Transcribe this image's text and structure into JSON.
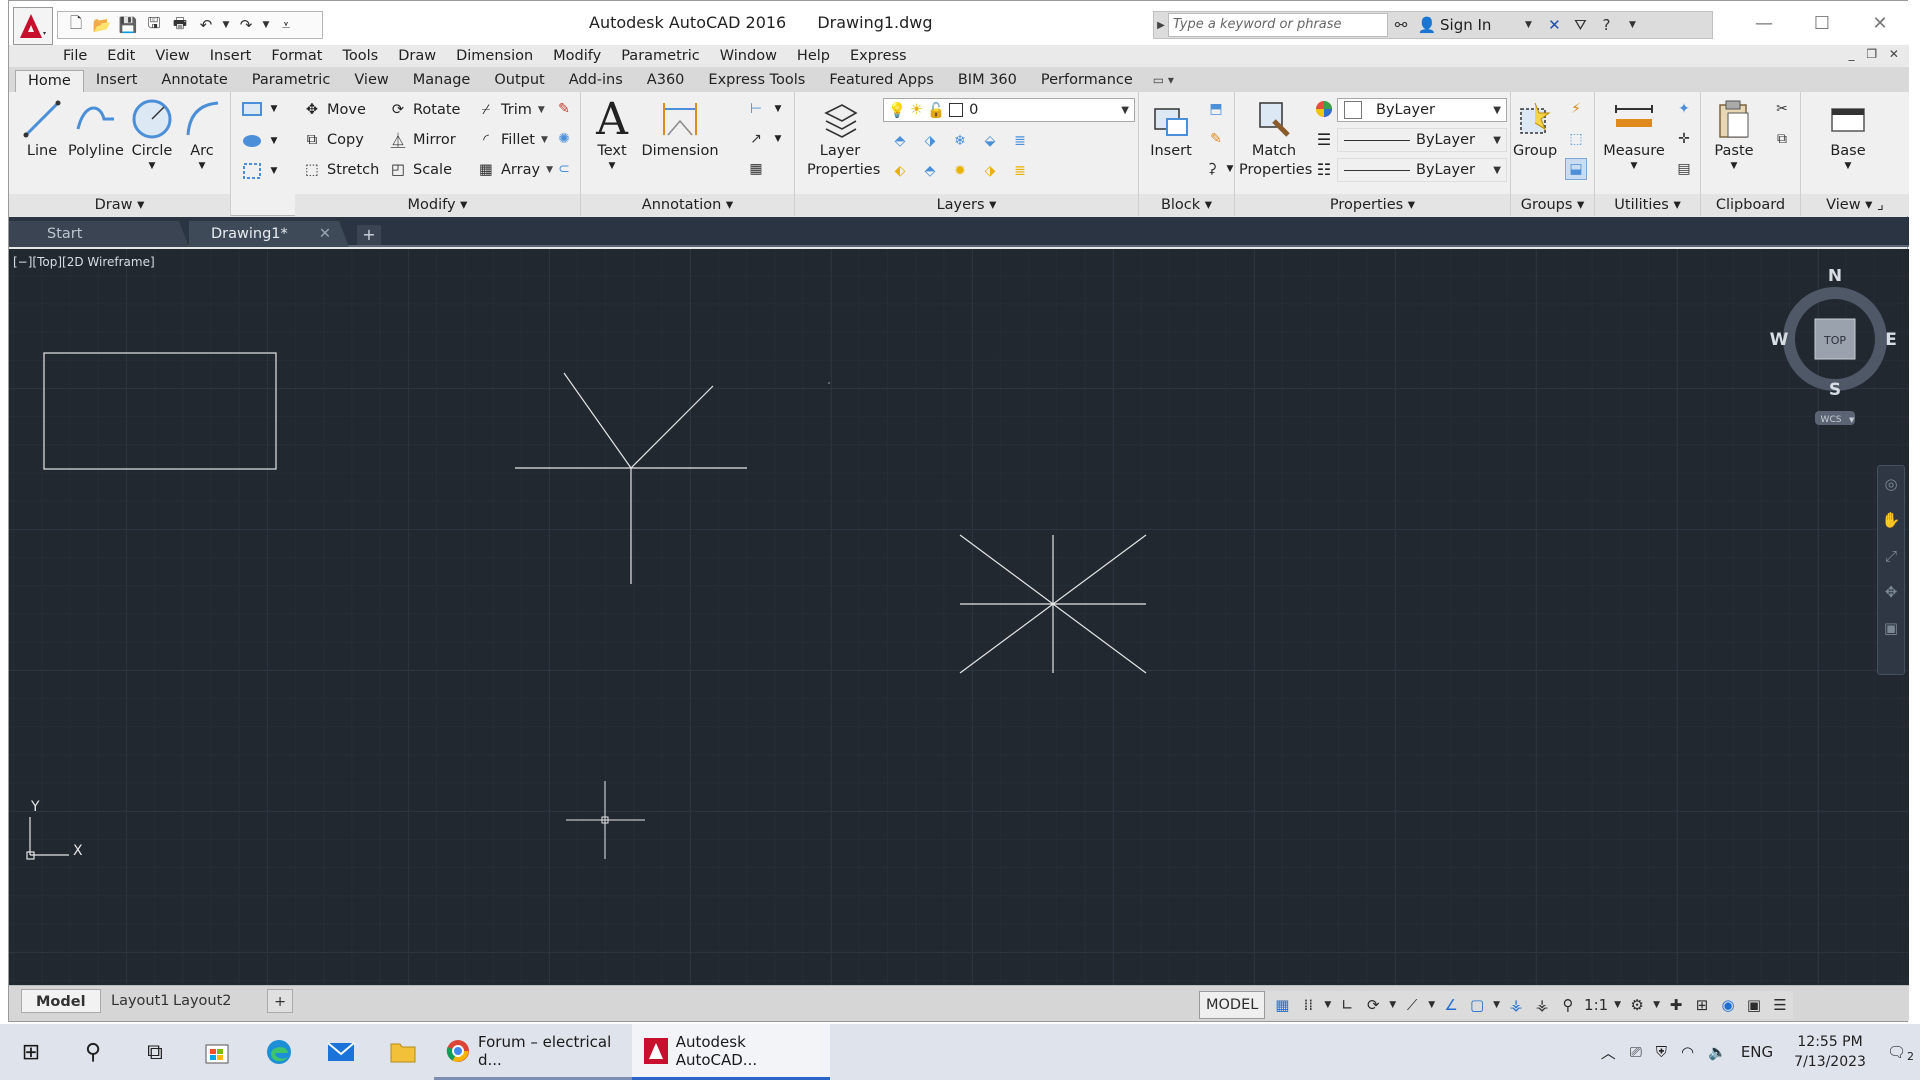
{
  "title": {
    "app": "Autodesk AutoCAD 2016",
    "file": "Drawing1.dwg"
  },
  "search": {
    "placeholder": "Type a keyword or phrase",
    "sign_in": "Sign In"
  },
  "menu": [
    "File",
    "Edit",
    "View",
    "Insert",
    "Format",
    "Tools",
    "Draw",
    "Dimension",
    "Modify",
    "Parametric",
    "Window",
    "Help",
    "Express"
  ],
  "ribbon_tabs": [
    "Home",
    "Insert",
    "Annotate",
    "Parametric",
    "View",
    "Manage",
    "Output",
    "Add-ins",
    "A360",
    "Express Tools",
    "Featured Apps",
    "BIM 360",
    "Performance"
  ],
  "draw_panel": {
    "title": "Draw",
    "line": "Line",
    "polyline": "Polyline",
    "circle": "Circle",
    "arc": "Arc"
  },
  "modify_panel": {
    "title": "Modify",
    "move": "Move",
    "rotate": "Rotate",
    "trim": "Trim",
    "copy": "Copy",
    "mirror": "Mirror",
    "fillet": "Fillet",
    "stretch": "Stretch",
    "scale": "Scale",
    "array": "Array"
  },
  "annotation_panel": {
    "title": "Annotation",
    "text": "Text",
    "dimension": "Dimension"
  },
  "layers_panel": {
    "title": "Layers",
    "layer_properties": "Layer Properties",
    "current_layer": "0"
  },
  "block_panel": {
    "title": "Block",
    "insert": "Insert"
  },
  "properties_panel": {
    "title": "Properties",
    "match_properties": "Match Properties",
    "color": "ByLayer",
    "linetype": "ByLayer",
    "lineweight": "ByLayer"
  },
  "groups_panel": {
    "title": "Groups",
    "group": "Group"
  },
  "utilities_panel": {
    "title": "Utilities",
    "measure": "Measure"
  },
  "clipboard_panel": {
    "title": "Clipboard",
    "paste": "Paste"
  },
  "view_panel": {
    "title": "View",
    "base": "Base"
  },
  "doc_tabs": {
    "start": "Start",
    "current": "Drawing1*"
  },
  "viewport": {
    "label": "[−][Top][2D Wireframe]",
    "compass": {
      "n": "N",
      "s": "S",
      "e": "E",
      "w": "W",
      "top": "TOP",
      "wcs": "WCS"
    },
    "ucs": {
      "x": "X",
      "y": "Y"
    }
  },
  "layout_tabs": [
    "Model",
    "Layout1",
    "Layout2"
  ],
  "status": {
    "model": "MODEL",
    "scale": "1:1"
  },
  "taskbar": {
    "apps": [
      {
        "label": "Forum – electrical d..."
      },
      {
        "label": "Autodesk AutoCAD..."
      }
    ],
    "language": "ENG",
    "time": "12:55 PM",
    "date": "7/13/2023",
    "notifications": "2"
  },
  "colors": {
    "canvas": "#212830",
    "accent": "#1f6fd1",
    "logo_red": "#c8102e"
  }
}
